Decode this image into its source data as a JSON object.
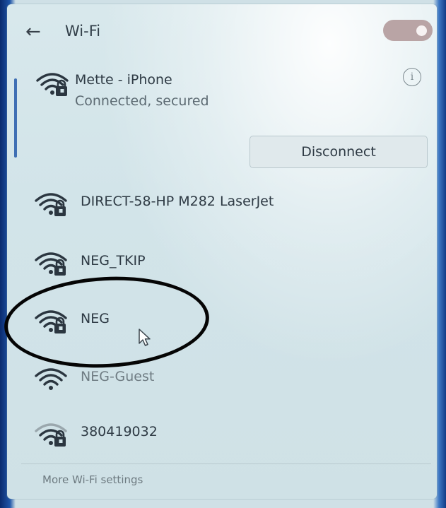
{
  "header": {
    "back_glyph": "←",
    "title": "Wi-Fi",
    "wifi_toggle_on": true
  },
  "connected_network": {
    "name": "Mette - iPhone",
    "status": "Connected, secured",
    "info_glyph": "i",
    "disconnect_label": "Disconnect",
    "icon": "wifi-secured-icon"
  },
  "networks": [
    {
      "name": "DIRECT-58-HP M282 LaserJet",
      "icon": "wifi-secured-icon"
    },
    {
      "name": "NEG_TKIP",
      "icon": "wifi-secured-icon"
    },
    {
      "name": "NEG",
      "icon": "wifi-secured-icon"
    },
    {
      "name": "NEG-Guest",
      "icon": "wifi-open-icon"
    },
    {
      "name": "380419032",
      "icon": "wifi-secured-icon"
    }
  ],
  "footer": {
    "more_settings_label": "More Wi-Fi settings"
  },
  "colors": {
    "toggle_on": "#b9a4a5",
    "panel_bg": "#d2e4e9",
    "annotation": "#050505",
    "scroll_accent": "#3f6fb4"
  }
}
